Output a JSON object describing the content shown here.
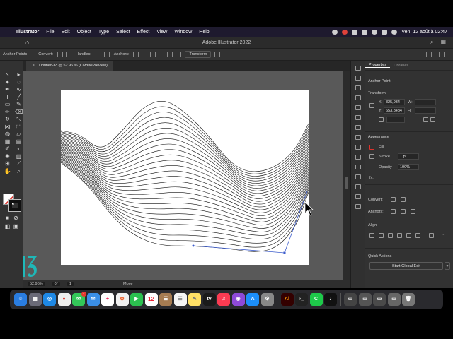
{
  "menubar": {
    "app_name": "Illustrator",
    "items": [
      "File",
      "Edit",
      "Object",
      "Type",
      "Select",
      "Effect",
      "View",
      "Window",
      "Help"
    ],
    "clock": "Ven. 12 août à 02:47"
  },
  "titlebar": {
    "title": "Adobe Illustrator 2022"
  },
  "controlbar": {
    "anchor_points": "Anchor Points",
    "convert": "Convert:",
    "handles": "Handles:",
    "anchors": "Anchors:",
    "transform": "Transform"
  },
  "document": {
    "tab_title": "Untitled-6* @ 52.96 % (CMYK/Preview)"
  },
  "statusbar": {
    "zoom": "52,96%",
    "angle": "0°",
    "artboard": "1",
    "tool": "Move"
  },
  "properties": {
    "tab_properties": "Properties",
    "tab_libraries": "Libraries",
    "selection_type": "Anchor Point",
    "transform_title": "Transform",
    "x_label": "X:",
    "x_value": "325,934 p",
    "y_label": "Y:",
    "y_value": "653,8484",
    "w_label": "W:",
    "h_label": "H:",
    "appearance_title": "Appearance",
    "fill_label": "Fill",
    "stroke_label": "Stroke",
    "stroke_value": "1 pt",
    "opacity_label": "Opacity",
    "opacity_value": "100%",
    "convert_label": "Convert:",
    "anchors_label": "Anchors:",
    "align_title": "Align",
    "quick_actions_title": "Quick Actions",
    "start_global_edit": "Start Global Edit"
  },
  "logo": {
    "text": "13"
  },
  "dock": {
    "calendar_date": "12",
    "badge": "1"
  },
  "colors": {
    "menubar_bg": "#1e1a2e",
    "panel_bg": "#323232",
    "canvas_bg": "#595959",
    "selection_blue": "#3d5dcc",
    "logo_teal": "#1fb8b8"
  }
}
